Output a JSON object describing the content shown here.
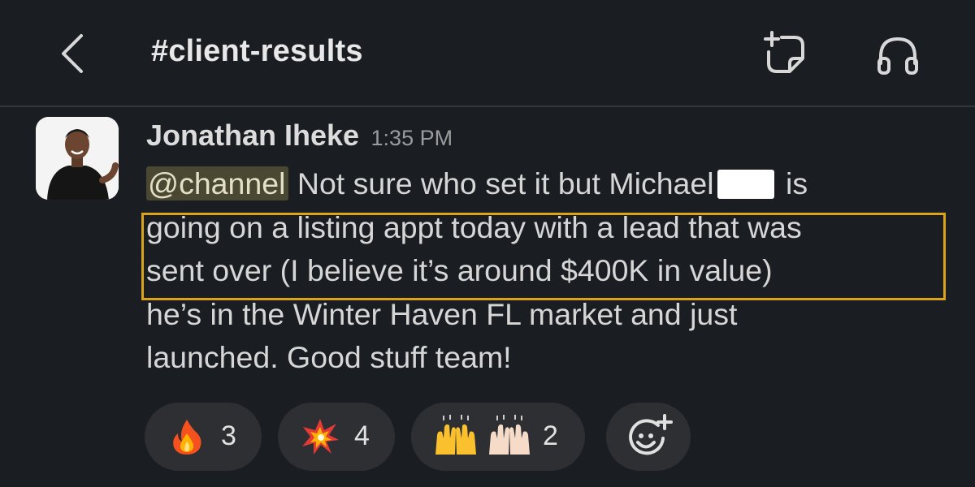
{
  "header": {
    "back_icon": "chevron-left-icon",
    "channel_name": "#client-results",
    "compose_icon": "compose-icon",
    "huddle_icon": "headphones-icon"
  },
  "message": {
    "author": "Jonathan Iheke",
    "time": "1:35 PM",
    "mention": "@channel",
    "line1_text": " Not sure who set it but Michael",
    "line1_after": " is",
    "line2": "going on a listing appt today with a lead that was",
    "line3": "sent over (I believe it’s around $400K in value)",
    "line4": "he’s in the Winter Haven FL market and just",
    "line5": "launched. Good stuff team!",
    "highlight_color": "#d9a31a"
  },
  "reactions": [
    {
      "emoji": "fire",
      "count": "3"
    },
    {
      "emoji": "collision",
      "count": "4"
    },
    {
      "emoji": "raising-hands",
      "count": "2"
    },
    {
      "emoji": "add-reaction-icon",
      "count": ""
    }
  ]
}
